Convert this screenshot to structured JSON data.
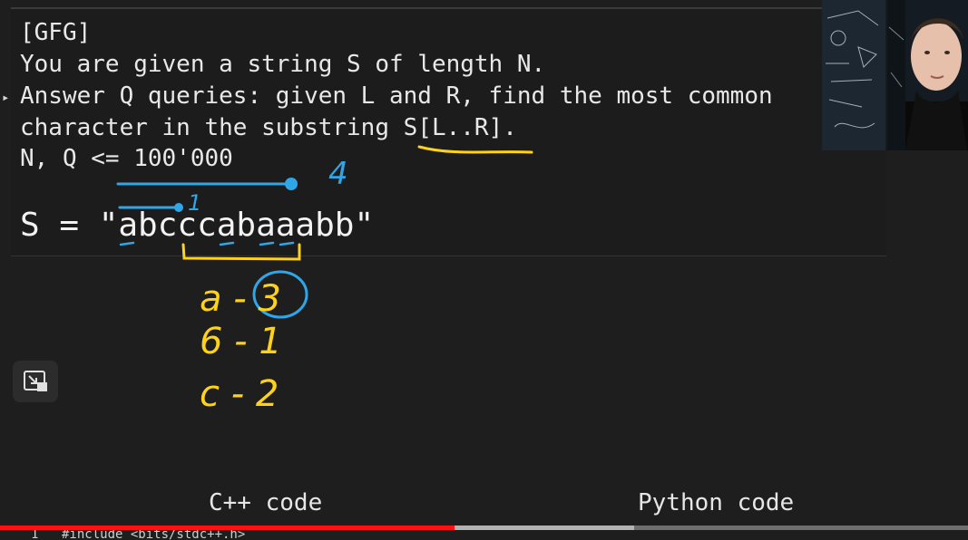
{
  "problem": {
    "line1": "[GFG]",
    "line2": "You are given a string S of length N.",
    "line3": "Answer Q queries: given L and R, find the most common",
    "line4": "character in the substring S[L..R].",
    "line5": "N, Q <= 100'000",
    "string_line": "S = \"abcccabaaabb\""
  },
  "handwriting": {
    "label_right": "4",
    "label_left": "1",
    "count_a": "a - 3",
    "count_b": "6 - 1",
    "count_c": "c - 2",
    "ink_blue": "#2fa6e8",
    "ink_yellow": "#ffd21a"
  },
  "tabs": {
    "cpp": "C++ code",
    "python": "Python code"
  },
  "player": {
    "played_fraction": 0.47,
    "buffered_fraction": 0.655
  },
  "code_preview": {
    "line_number": "1",
    "text": "#include <bits/stdc++.h>"
  },
  "icons": {
    "pip": "picture-in-picture-icon",
    "marker": "arrow-marker-icon"
  }
}
